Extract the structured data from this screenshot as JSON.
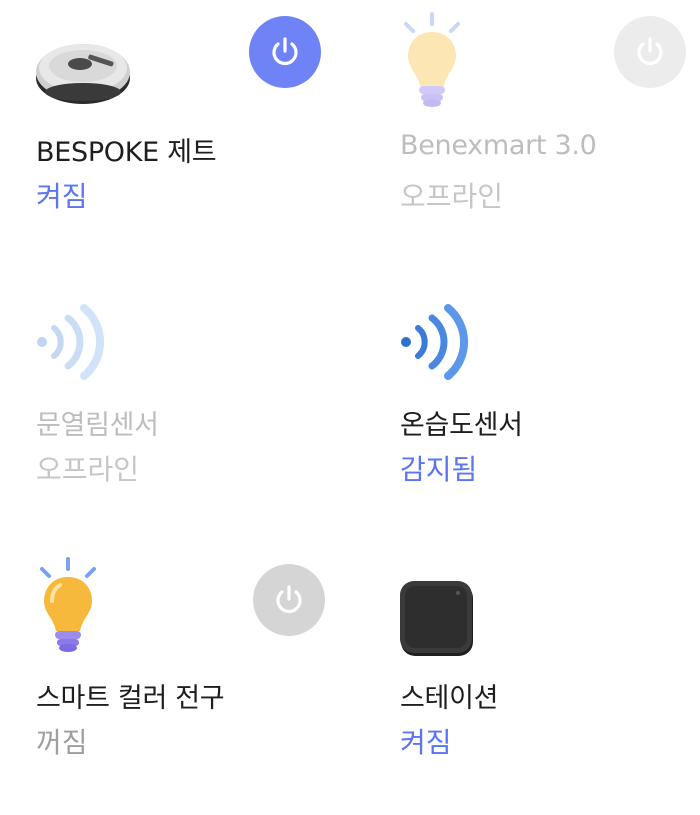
{
  "devices": [
    {
      "name": "BESPOKE 제트",
      "status": "켜짐",
      "icon": "robot-vacuum-icon",
      "power": "on"
    },
    {
      "name": "Benexmart 3.0",
      "status": "오프라인",
      "icon": "light-bulb-icon",
      "power": "offline"
    },
    {
      "name": "문열림센서",
      "status": "오프라인",
      "icon": "wireless-sensor-icon",
      "power": null
    },
    {
      "name": "온습도센서",
      "status": "감지됨",
      "icon": "wireless-sensor-icon",
      "power": null
    },
    {
      "name": "스마트 컬러 전구",
      "status": "꺼짐",
      "icon": "light-bulb-icon",
      "power": "off"
    },
    {
      "name": "스테이션",
      "status": "켜짐",
      "icon": "station-hub-icon",
      "power": null
    }
  ],
  "colors": {
    "accent": "#5b74f4",
    "power_on": "#6f83f7",
    "power_off": "#d5d5d5",
    "offline_text": "#c6c6c6"
  }
}
